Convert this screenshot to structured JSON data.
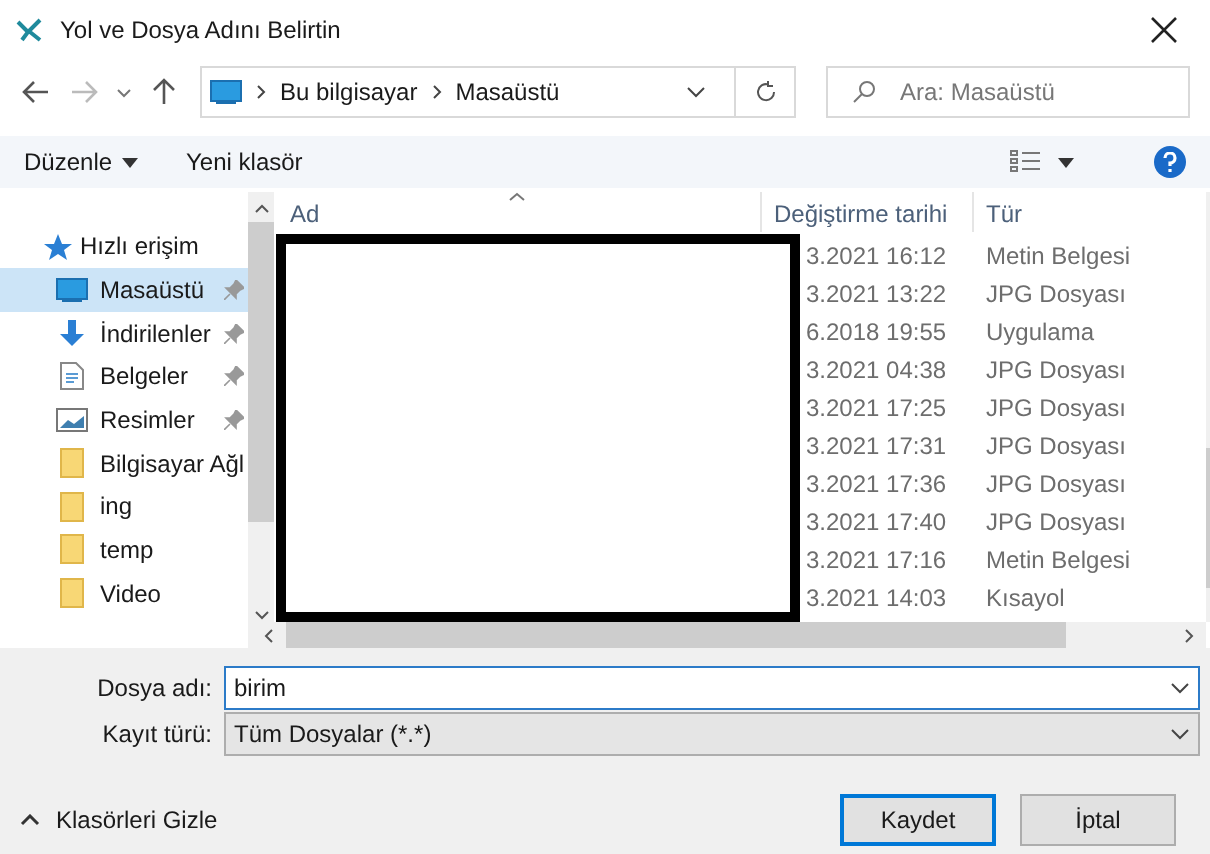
{
  "window": {
    "title": "Yol ve Dosya Adını Belirtin"
  },
  "address": {
    "crumbs": [
      "Bu bilgisayar",
      "Masaüstü"
    ]
  },
  "search": {
    "placeholder": "Ara: Masaüstü"
  },
  "toolbar": {
    "organize": "Düzenle",
    "new_folder": "Yeni klasör"
  },
  "sidebar": {
    "header": "Hızlı erişim",
    "items": [
      {
        "label": "Masaüstü",
        "kind": "desktop",
        "pinned": true,
        "selected": true
      },
      {
        "label": "İndirilenler",
        "kind": "download",
        "pinned": true,
        "selected": false
      },
      {
        "label": "Belgeler",
        "kind": "document",
        "pinned": true,
        "selected": false
      },
      {
        "label": "Resimler",
        "kind": "picture",
        "pinned": true,
        "selected": false
      },
      {
        "label": "Bilgisayar Ağl",
        "kind": "folder",
        "pinned": false,
        "selected": false
      },
      {
        "label": "ing",
        "kind": "folder",
        "pinned": false,
        "selected": false
      },
      {
        "label": "temp",
        "kind": "folder",
        "pinned": false,
        "selected": false
      },
      {
        "label": "Video",
        "kind": "folder",
        "pinned": false,
        "selected": false
      }
    ]
  },
  "table": {
    "columns": [
      "Ad",
      "Değiştirme tarihi",
      "Tür"
    ],
    "rows": [
      {
        "date": "3.2021 16:12",
        "type": "Metin Belgesi"
      },
      {
        "date": "3.2021 13:22",
        "type": "JPG Dosyası"
      },
      {
        "date": "6.2018 19:55",
        "type": "Uygulama"
      },
      {
        "date": "3.2021 04:38",
        "type": "JPG Dosyası"
      },
      {
        "date": "3.2021 17:25",
        "type": "JPG Dosyası"
      },
      {
        "date": "3.2021 17:31",
        "type": "JPG Dosyası"
      },
      {
        "date": "3.2021 17:36",
        "type": "JPG Dosyası"
      },
      {
        "date": "3.2021 17:40",
        "type": "JPG Dosyası"
      },
      {
        "date": "3.2021 17:16",
        "type": "Metin Belgesi"
      },
      {
        "date": "3.2021 14:03",
        "type": "Kısayol"
      }
    ]
  },
  "file_name": {
    "label": "Dosya adı:",
    "value": "birim"
  },
  "file_type": {
    "label": "Kayıt türü:",
    "value": "Tüm Dosyalar (*.*)"
  },
  "hide_folders": "Klasörleri Gizle",
  "buttons": [
    "Kaydet",
    "İptal"
  ]
}
